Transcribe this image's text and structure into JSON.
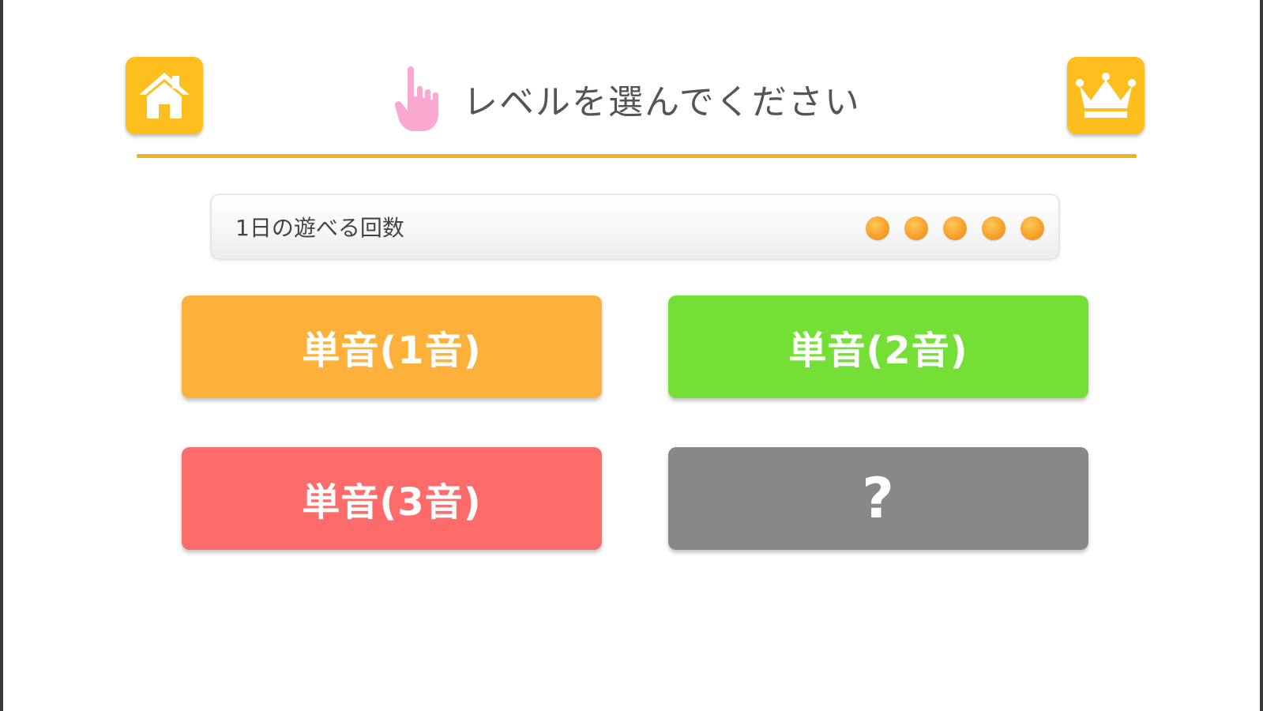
{
  "header": {
    "title": "レベルを選んでください",
    "home_icon": "home-icon",
    "pointer_icon": "pointing-hand-icon",
    "crown_icon": "crown-icon"
  },
  "plays": {
    "label": "1日の遊べる回数",
    "remaining": 5,
    "total": 5
  },
  "levels": [
    {
      "label": "単音(1音)",
      "color": "#fdb13a"
    },
    {
      "label": "単音(2音)",
      "color": "#74e035"
    },
    {
      "label": "単音(3音)",
      "color": "#fe6b6b"
    },
    {
      "label": "?",
      "color": "#888888"
    }
  ],
  "colors": {
    "accent": "#fdbf1e",
    "rule": "#f4b21a",
    "pointer": "#f9a9cf",
    "dot": "#f7a22b"
  }
}
